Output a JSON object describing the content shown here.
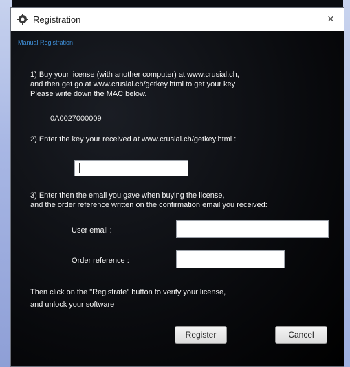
{
  "window": {
    "title": "Registration",
    "close_glyph": "×",
    "icon": "gear-icon"
  },
  "section": {
    "label": "Manual Registration"
  },
  "step1": {
    "line1": "1) Buy your license (with another computer) at www.crusial.ch,",
    "line2": "and then get go at www.crusial.ch/getkey.html to get your key",
    "line3": "Please write down the MAC below."
  },
  "mac_address": "0A0027000009",
  "step2": {
    "text": "2) Enter the key your received at www.crusial.ch/getkey.html :"
  },
  "key_input": {
    "value": ""
  },
  "step3": {
    "line1": "3) Enter then the email you gave when buying the license,",
    "line2": "and the order reference written on the confirmation email you received:"
  },
  "email_field": {
    "label": "User email :",
    "value": ""
  },
  "order_field": {
    "label": "Order reference :",
    "value": ""
  },
  "final": {
    "line1": "Then click on the \"Registrate\" button to verify your license,",
    "line2": "and unlock your software"
  },
  "buttons": {
    "register": "Register",
    "cancel": "Cancel"
  }
}
